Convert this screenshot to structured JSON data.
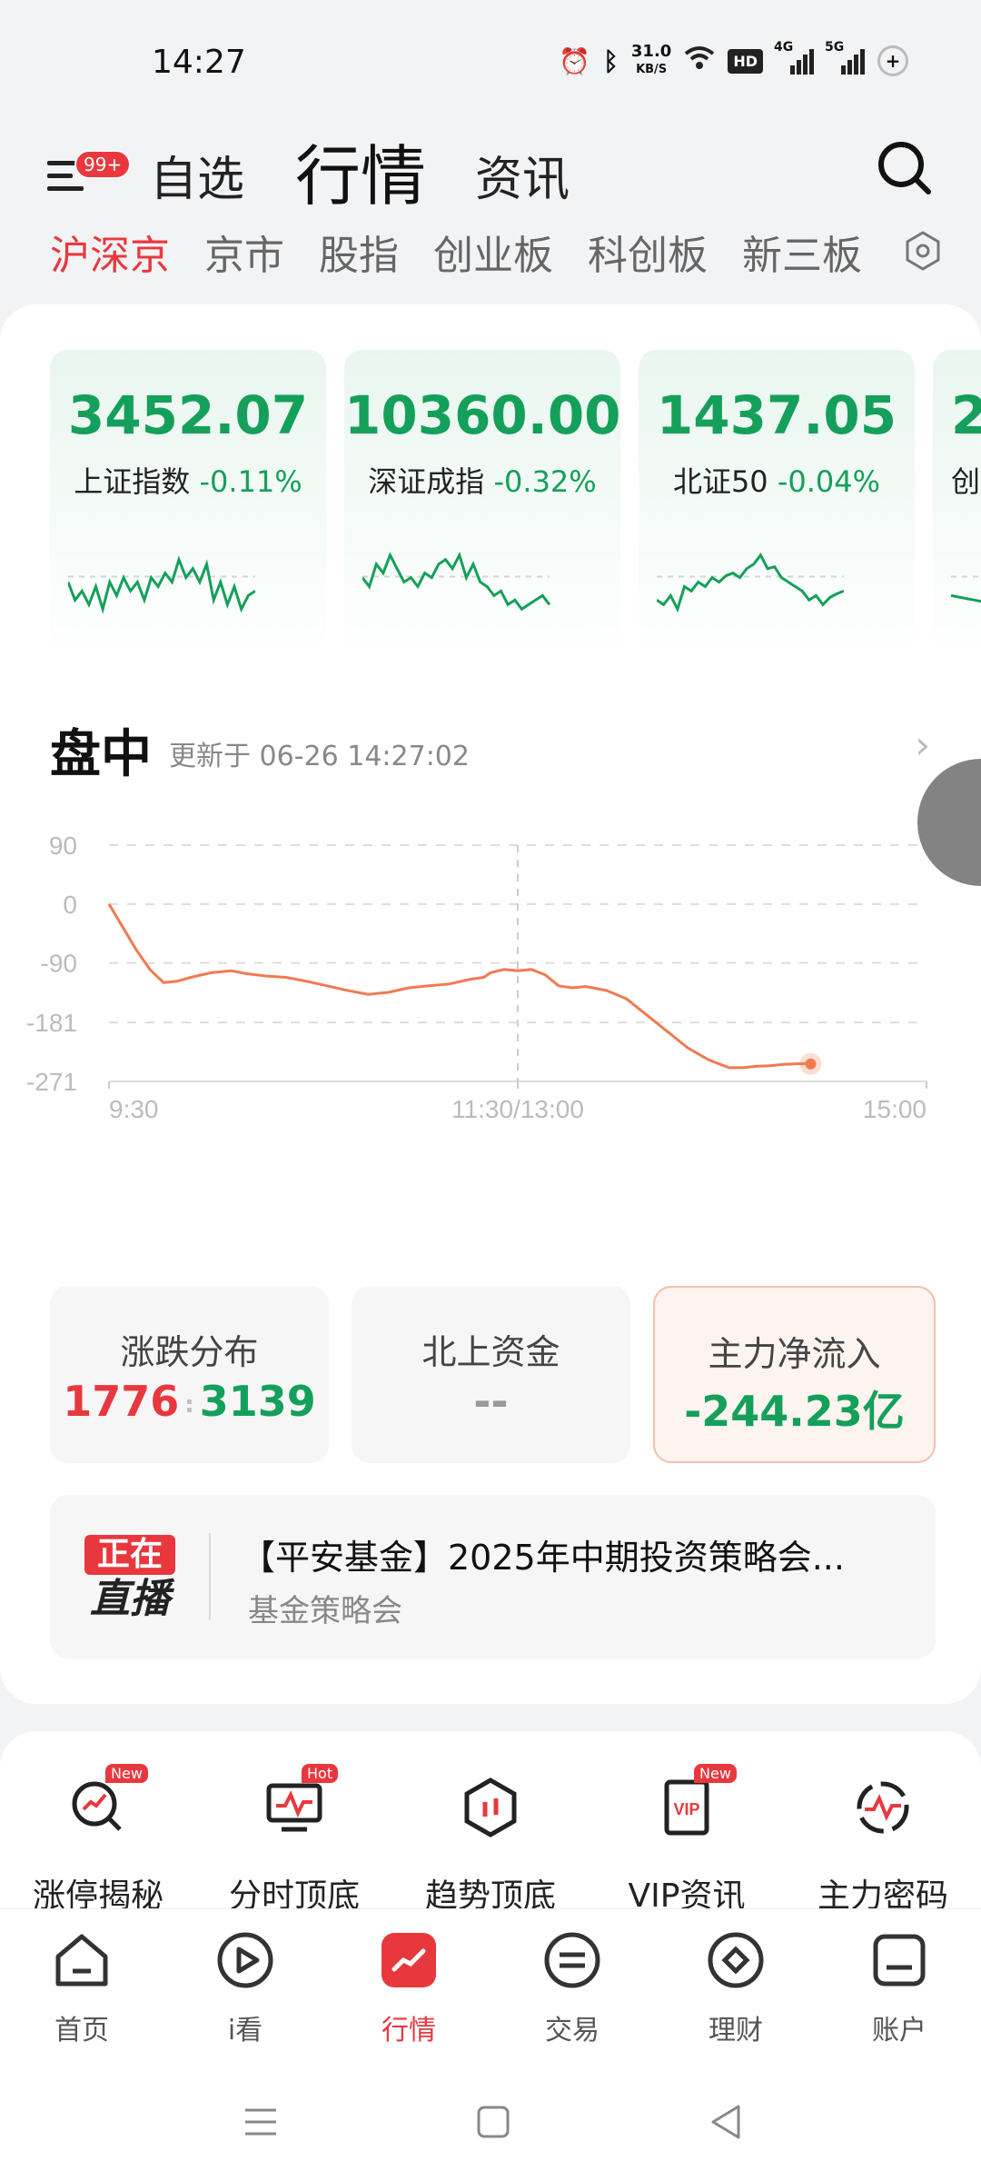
{
  "status_bar": {
    "time": "14:27",
    "net_speed_value": "31.0",
    "net_speed_unit": "KB/S",
    "hd_label": "HD",
    "signal1_label": "4G",
    "signal2_label": "5G",
    "icons": [
      "alarm-icon",
      "bluetooth-icon",
      "wifi-icon",
      "battery-icon"
    ]
  },
  "header": {
    "badge": "99+",
    "tabs": [
      "自选",
      "行情",
      "资讯"
    ],
    "active_tab": "行情"
  },
  "market_tabs": {
    "items": [
      "沪深京",
      "京市",
      "股指",
      "创业板",
      "科创板",
      "新三板"
    ],
    "active": "沪深京"
  },
  "indices": [
    {
      "value": "3452.07",
      "name": "上证指数",
      "change": "-0.11%",
      "spark": [
        0.55,
        0.35,
        0.45,
        0.3,
        0.5,
        0.25,
        0.55,
        0.4,
        0.6,
        0.45,
        0.55,
        0.35,
        0.6,
        0.5,
        0.65,
        0.55,
        0.8,
        0.6,
        0.7,
        0.55,
        0.75,
        0.35,
        0.55,
        0.3,
        0.5,
        0.25,
        0.4,
        0.45
      ]
    },
    {
      "value": "10360.00",
      "name": "深证成指",
      "change": "-0.32%",
      "spark": [
        0.6,
        0.5,
        0.75,
        0.65,
        0.85,
        0.7,
        0.55,
        0.6,
        0.5,
        0.65,
        0.6,
        0.75,
        0.8,
        0.7,
        0.85,
        0.6,
        0.75,
        0.55,
        0.5,
        0.4,
        0.45,
        0.3,
        0.35,
        0.25,
        0.3,
        0.35,
        0.4,
        0.3
      ]
    },
    {
      "value": "1437.05",
      "name": "北证50",
      "change": "-0.04%",
      "spark": [
        0.35,
        0.3,
        0.4,
        0.25,
        0.5,
        0.45,
        0.55,
        0.5,
        0.6,
        0.55,
        0.62,
        0.65,
        0.6,
        0.7,
        0.75,
        0.85,
        0.7,
        0.72,
        0.6,
        0.55,
        0.5,
        0.45,
        0.35,
        0.4,
        0.3,
        0.38,
        0.42,
        0.45
      ]
    },
    {
      "value": "2",
      "name": "创",
      "change": "",
      "spark": [
        0.4,
        0.3,
        0.5,
        0.35,
        0.6
      ]
    }
  ],
  "section": {
    "title": "盘中",
    "update_text": "更新于 06-26 14:27:02"
  },
  "chart_data": {
    "type": "line",
    "title": "",
    "xlabel": "",
    "ylabel": "",
    "x_ticks": [
      "9:30",
      "11:30/13:00",
      "15:00"
    ],
    "y_ticks": [
      "90",
      "0",
      "-90",
      "-181",
      "-271"
    ],
    "ylim": [
      -271,
      90
    ],
    "x_domain": [
      0,
      240
    ],
    "grid": true,
    "series": [
      {
        "name": "",
        "color": "#f07a52",
        "x": [
          0,
          4,
          8,
          12,
          16,
          20,
          24,
          30,
          36,
          40,
          46,
          52,
          58,
          64,
          70,
          76,
          82,
          88,
          94,
          100,
          106,
          110,
          112,
          116,
          120,
          124,
          128,
          132,
          136,
          140,
          146,
          152,
          158,
          164,
          170,
          176,
          182,
          186,
          190,
          194,
          198,
          202,
          206
        ],
        "values": [
          0,
          -35,
          -70,
          -100,
          -120,
          -118,
          -112,
          -105,
          -102,
          -106,
          -110,
          -112,
          -118,
          -125,
          -132,
          -138,
          -135,
          -128,
          -125,
          -122,
          -115,
          -112,
          -105,
          -100,
          -102,
          -100,
          -108,
          -125,
          -128,
          -126,
          -132,
          -145,
          -170,
          -195,
          -220,
          -238,
          -250,
          -250,
          -248,
          -247,
          -245,
          -244,
          -244.23
        ]
      }
    ]
  },
  "stats": [
    {
      "title": "涨跌分布",
      "up": "1776",
      "sep": ":",
      "down": "3139"
    },
    {
      "title": "北上资金",
      "value": "--"
    },
    {
      "title": "主力净流入",
      "value": "-244.23亿"
    }
  ],
  "live": {
    "badge_top": "正在",
    "badge_bottom": "直播",
    "title": "【平安基金】2025年中期投资策略会...",
    "subtitle": "基金策略会"
  },
  "features": [
    {
      "label": "涨停揭秘",
      "tag": "New"
    },
    {
      "label": "分时顶底",
      "tag": "Hot"
    },
    {
      "label": "趋势顶底",
      "tag": ""
    },
    {
      "label": "VIP资讯",
      "tag": "New"
    },
    {
      "label": "主力密码",
      "tag": ""
    }
  ],
  "bottom_nav": {
    "items": [
      "首页",
      "i看",
      "行情",
      "交易",
      "理财",
      "账户"
    ],
    "active": "行情"
  },
  "colors": {
    "accent": "#e8383d",
    "up": "#e8383d",
    "down": "#14a05a",
    "chart_line": "#f07a52"
  }
}
